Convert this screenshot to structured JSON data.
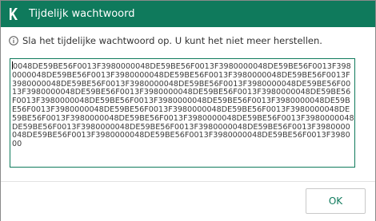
{
  "window": {
    "title": "Tijdelijk wachtwoord",
    "accent_color": "#0f7a5c"
  },
  "info": {
    "icon": "info-icon",
    "message": "Sla het tijdelijke wachtwoord op. U kunt het niet meer herstellen."
  },
  "password": {
    "value": "0048DE59BE56F0013F3980000048DE59BE56F0013F3980000048DE59BE56F0013F3980000048DE59BE56F0013F3980000048DE59BE56F0013F3980000048DE59BE56F0013F3980000048DE59BE56F0013F3980000048DE59BE56F0013F3980000048DE59BE56F0013F3980000048DE59BE56F0013F3980000048DE59BE56F0013F3980000048DE59BE56F0013F3980000048DE59BE56F0013F3980000048DE59BE56F0013F3980000048DE59BE56F0013F3980000048DE59BE56F0013F3980000048DE59BE56F0013F3980000048DE59BE56F0013F3980000048DE59BE56F0013F3980000048DE59BE56F0013F3980000048DE59BE56F0013F3980000048DE59BE56F0013F3980000048DE59BE56F0013F3980000048DE59BE56F0013F3980000048DE59BE56F0013F3980000048DE59BE56F0013F398000"
  },
  "footer": {
    "ok_label": "OK"
  }
}
